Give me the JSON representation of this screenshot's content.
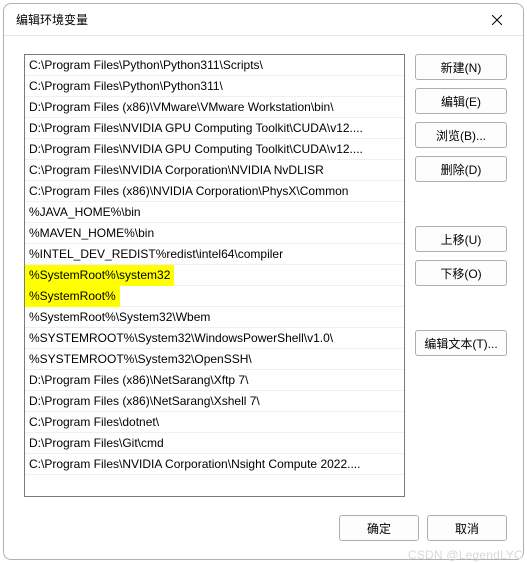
{
  "window": {
    "title": "编辑环境变量"
  },
  "list": {
    "items": [
      {
        "text": "C:\\Program Files\\Python\\Python311\\Scripts\\",
        "highlight": false
      },
      {
        "text": "C:\\Program Files\\Python\\Python311\\",
        "highlight": false
      },
      {
        "text": "D:\\Program Files (x86)\\VMware\\VMware Workstation\\bin\\",
        "highlight": false
      },
      {
        "text": "D:\\Program Files\\NVIDIA GPU Computing Toolkit\\CUDA\\v12....",
        "highlight": false
      },
      {
        "text": "D:\\Program Files\\NVIDIA GPU Computing Toolkit\\CUDA\\v12....",
        "highlight": false
      },
      {
        "text": "C:\\Program Files\\NVIDIA Corporation\\NVIDIA NvDLISR",
        "highlight": false
      },
      {
        "text": "C:\\Program Files (x86)\\NVIDIA Corporation\\PhysX\\Common",
        "highlight": false
      },
      {
        "text": "%JAVA_HOME%\\bin",
        "highlight": false
      },
      {
        "text": "%MAVEN_HOME%\\bin",
        "highlight": false
      },
      {
        "text": "%INTEL_DEV_REDIST%redist\\intel64\\compiler",
        "highlight": false
      },
      {
        "text": "%SystemRoot%\\system32",
        "highlight": true
      },
      {
        "text": "%SystemRoot%",
        "highlight": true
      },
      {
        "text": "%SystemRoot%\\System32\\Wbem",
        "highlight": false
      },
      {
        "text": "%SYSTEMROOT%\\System32\\WindowsPowerShell\\v1.0\\",
        "highlight": false
      },
      {
        "text": "%SYSTEMROOT%\\System32\\OpenSSH\\",
        "highlight": false
      },
      {
        "text": "D:\\Program Files (x86)\\NetSarang\\Xftp 7\\",
        "highlight": false
      },
      {
        "text": "D:\\Program Files (x86)\\NetSarang\\Xshell 7\\",
        "highlight": false
      },
      {
        "text": "C:\\Program Files\\dotnet\\",
        "highlight": false
      },
      {
        "text": "D:\\Program Files\\Git\\cmd",
        "highlight": false
      },
      {
        "text": "C:\\Program Files\\NVIDIA Corporation\\Nsight Compute 2022....",
        "highlight": false
      }
    ]
  },
  "buttons": {
    "new": "新建(N)",
    "edit": "编辑(E)",
    "browse": "浏览(B)...",
    "delete": "删除(D)",
    "moveup": "上移(U)",
    "movedown": "下移(O)",
    "edittext": "编辑文本(T)...",
    "ok": "确定",
    "cancel": "取消"
  },
  "watermark": "CSDN @LegendLYC"
}
